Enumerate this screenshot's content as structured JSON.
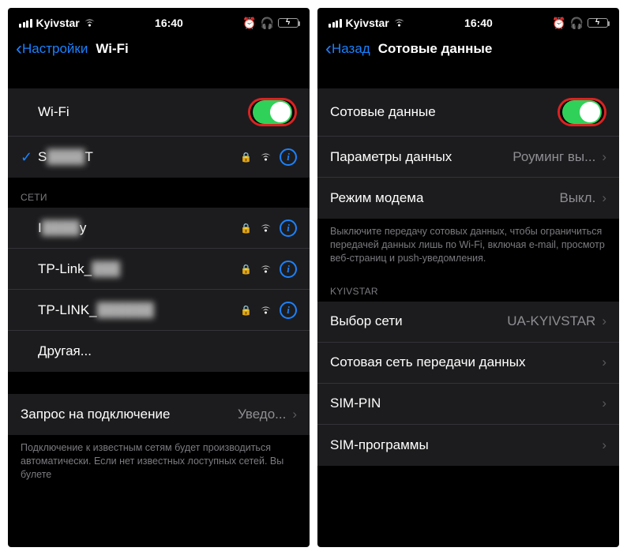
{
  "left": {
    "status": {
      "carrier": "Kyivstar",
      "time": "16:40"
    },
    "nav": {
      "back": "Настройки",
      "title": "Wi-Fi"
    },
    "top": {
      "wifi_label": "Wi-Fi",
      "connected_prefix": "S",
      "connected_name_hidden": "████",
      "connected_suffix": "T"
    },
    "networks_label": "СЕТИ",
    "networks": [
      {
        "prefix": "I",
        "name": "████",
        "suffix": "y"
      },
      {
        "prefix": "TP-Link_",
        "name": "███",
        "suffix": ""
      },
      {
        "prefix": "TP-LINK_",
        "name": "██████",
        "suffix": ""
      },
      {
        "other": "Другая..."
      }
    ],
    "ask_join_label": "Запрос на подключение",
    "ask_join_value": "Уведо...",
    "footer": "Подключение к известным сетям будет производиться автоматически. Если нет известных лоступных сетей. Вы булете"
  },
  "right": {
    "status": {
      "carrier": "Kyivstar",
      "time": "16:40"
    },
    "nav": {
      "back": "Назад",
      "title": "Сотовые данные"
    },
    "top": {
      "cellular_label": "Сотовые данные",
      "options_label": "Параметры данных",
      "options_value": "Роуминг вы...",
      "hotspot_label": "Режим модема",
      "hotspot_value": "Выкл."
    },
    "footer1": "Выключите передачу сотовых данных, чтобы ограничиться передачей данных лишь по Wi-Fi, включая e-mail, просмотр веб-страниц и push-уведомления.",
    "carrier_section": "KYIVSTAR",
    "rows": {
      "net_sel_label": "Выбор сети",
      "net_sel_value": "UA-KYIVSTAR",
      "datanet_label": "Сотовая сеть передачи данных",
      "simpin_label": "SIM-PIN",
      "simapps_label": "SIM-программы"
    }
  }
}
